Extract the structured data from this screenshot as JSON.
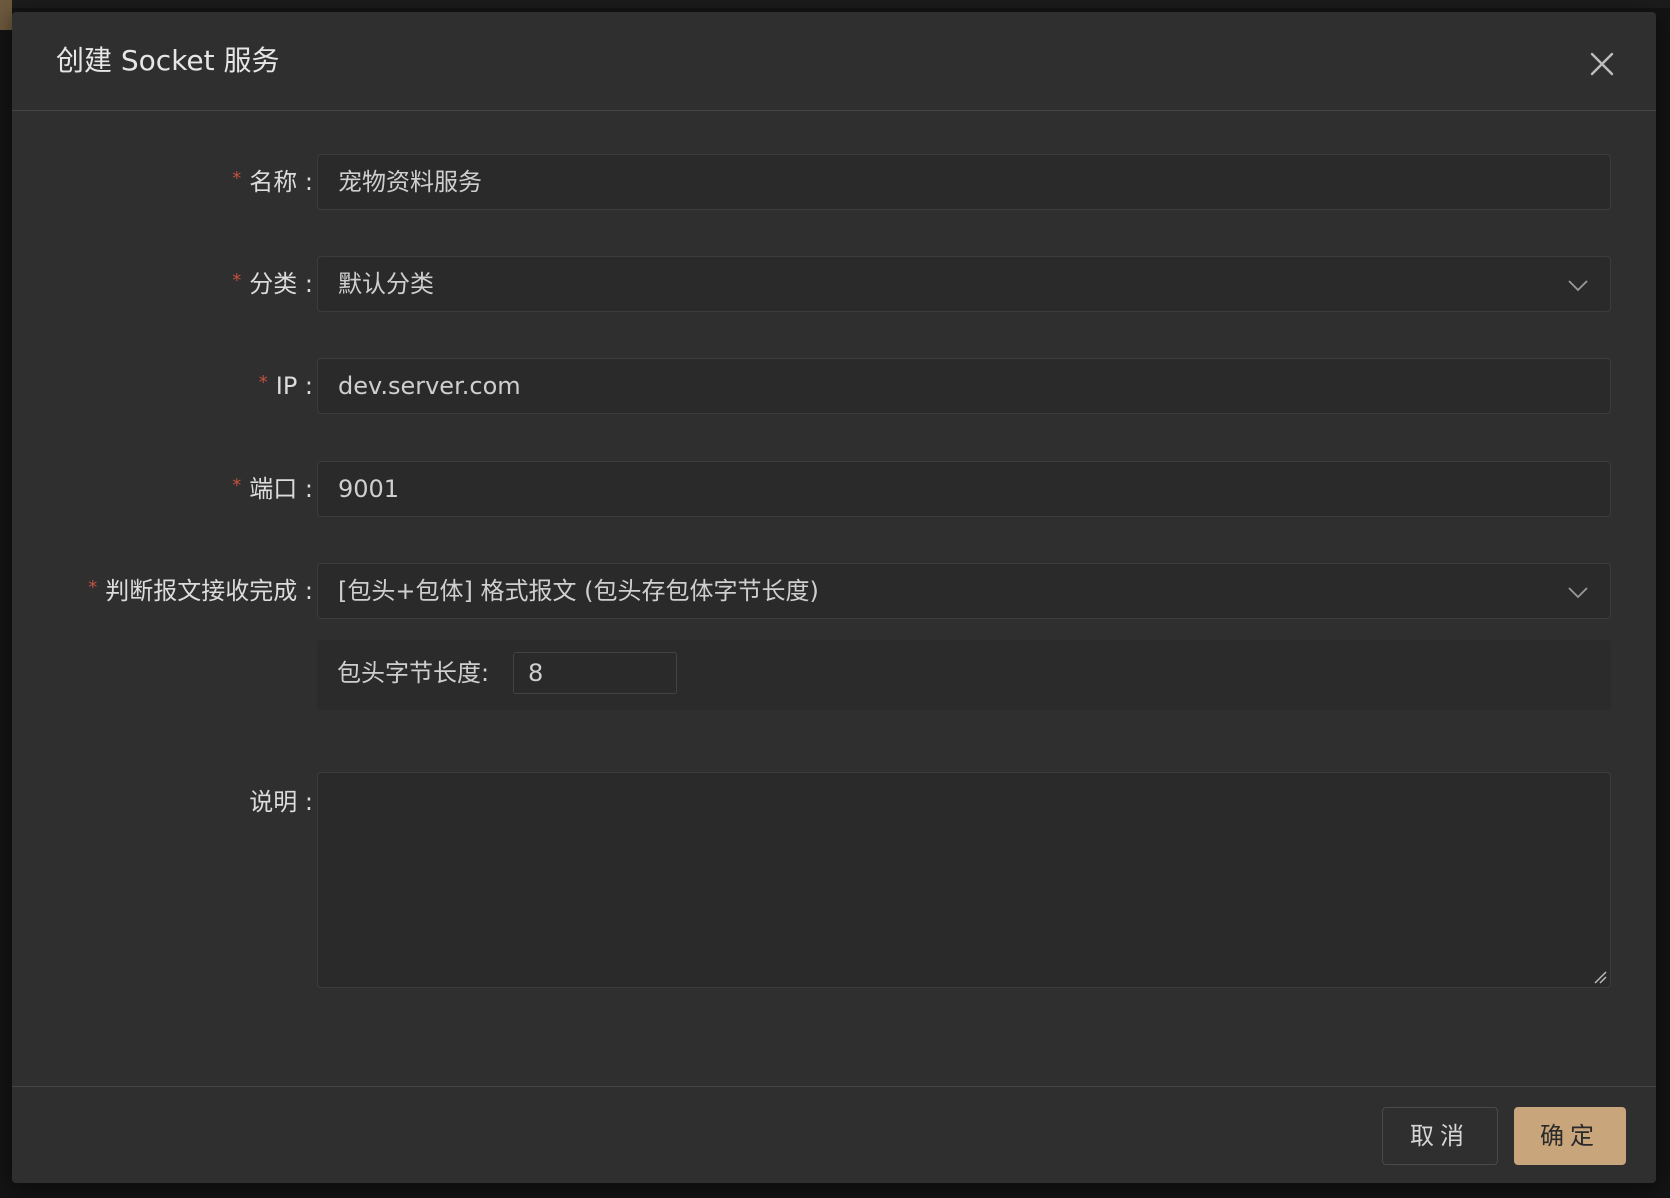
{
  "dialog": {
    "title": "创建 Socket 服务",
    "close_icon": "close-icon"
  },
  "form": {
    "name": {
      "required": "*",
      "label": "名称 :",
      "value": "宠物资料服务"
    },
    "category": {
      "required": "*",
      "label": "分类 :",
      "value": "默认分类"
    },
    "ip": {
      "required": "*",
      "label": "IP :",
      "value": "dev.server.com"
    },
    "port": {
      "required": "*",
      "label": "端口 :",
      "value": "9001"
    },
    "completion": {
      "required": "*",
      "label": "判断报文接收完成 :",
      "value": "[包头+包体] 格式报文 (包头存包体字节长度)",
      "sub_label": "包头字节长度:",
      "sub_value": "8"
    },
    "description": {
      "label": "说明 :",
      "value": ""
    }
  },
  "footer": {
    "cancel_label": "取消",
    "ok_label": "确定"
  },
  "colors": {
    "accent": "#c8a57b",
    "required": "#c4503f",
    "background": "#2f2f2f"
  }
}
